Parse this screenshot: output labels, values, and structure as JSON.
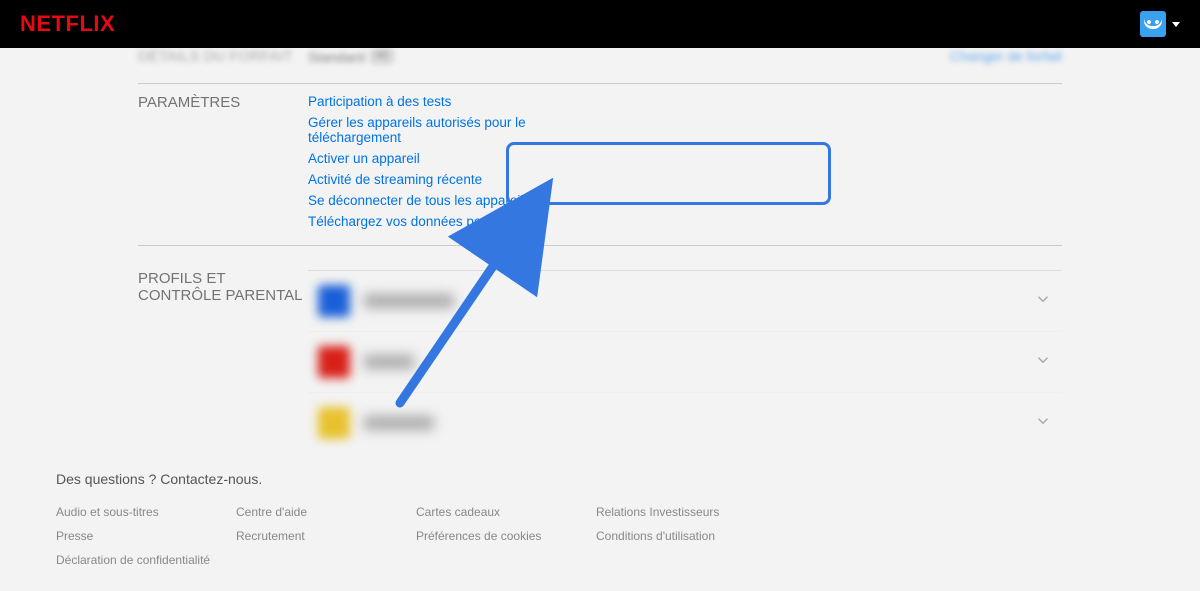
{
  "brand": "NETFLIX",
  "plan": {
    "section_label": "DÉTAILS DU FORFAIT",
    "name": "Standard",
    "badge": "HD",
    "change": "Changer de forfait"
  },
  "settings": {
    "section_label": "PARAMÈTRES",
    "links": [
      "Participation à des tests",
      "Gérer les appareils autorisés pour le téléchargement",
      "Activer un appareil",
      "Activité de streaming récente",
      "Se déconnecter de tous les appareils",
      "Téléchargez vos données personnelles"
    ]
  },
  "profiles": {
    "section_label": "PROFILS ET CONTRÔLE PARENTAL"
  },
  "footer": {
    "title": "Des questions ? Contactez-nous.",
    "cols": [
      [
        "Audio et sous-titres",
        "Presse",
        "Déclaration de confidentialité"
      ],
      [
        "Centre d'aide",
        "Recrutement"
      ],
      [
        "Cartes cadeaux",
        "Préférences de cookies"
      ],
      [
        "Relations Investisseurs",
        "Conditions d'utilisation"
      ]
    ]
  }
}
